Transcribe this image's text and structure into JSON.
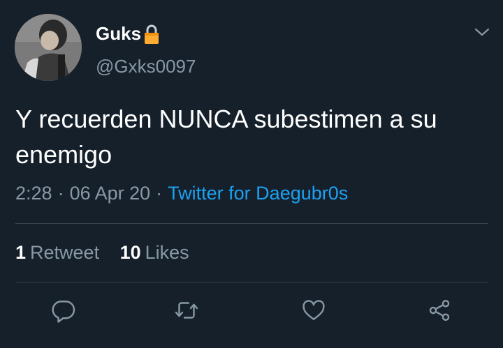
{
  "user": {
    "display_name": "Guks",
    "handle": "@Gxks0097",
    "protected_icon": "lock-icon"
  },
  "tweet": {
    "text": "Y recuerden NUNCA subestimen a su enemigo",
    "time": "2:28",
    "date": "06 Apr 20",
    "separator": "·",
    "source": "Twitter for Daegubr0s"
  },
  "stats": {
    "retweets_count": "1",
    "retweets_label": "Retweet",
    "likes_count": "10",
    "likes_label": "Likes"
  },
  "actions": [
    "reply-icon",
    "retweet-icon",
    "like-icon",
    "share-icon"
  ],
  "colors": {
    "background": "#15202b",
    "text": "#ffffff",
    "secondary": "#8899a6",
    "link": "#1da1f2",
    "divider": "#38444d",
    "lock": "#ffac33"
  }
}
